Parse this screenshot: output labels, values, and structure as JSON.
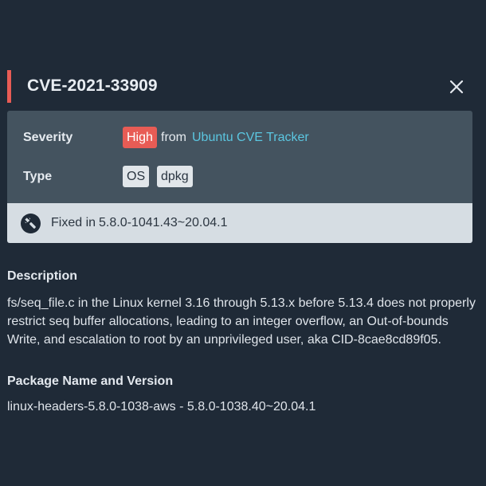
{
  "header": {
    "title": "CVE-2021-33909",
    "close_icon": "close-icon"
  },
  "colors": {
    "accent": "#e85c55",
    "link": "#5bc6e0",
    "background": "#1f2a37",
    "card": "#44535f"
  },
  "details": {
    "severity_label": "Severity",
    "severity_value": "High",
    "severity_from": "from",
    "severity_source": "Ubuntu CVE Tracker",
    "type_label": "Type",
    "type_tags": [
      "OS",
      "dpkg"
    ]
  },
  "fix": {
    "icon": "wrench-icon",
    "label": "Fixed in",
    "version": "5.8.0-1041.43~20.04.1"
  },
  "description": {
    "heading": "Description",
    "text": "fs/seq_file.c in the Linux kernel 3.16 through 5.13.x before 5.13.4 does not properly restrict seq buffer allocations, leading to an integer overflow, an Out-of-bounds Write, and escalation to root by an unprivileged user, aka CID-8cae8cd89f05."
  },
  "package": {
    "heading": "Package Name and Version",
    "value": "linux-headers-5.8.0-1038-aws - 5.8.0-1038.40~20.04.1"
  }
}
